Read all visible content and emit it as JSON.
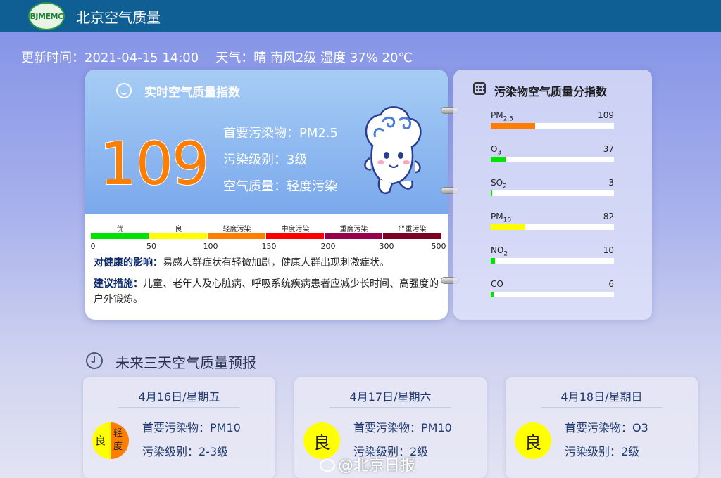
{
  "header": {
    "logo_text": "BJMEMC",
    "title": "北京空气质量"
  },
  "update": {
    "label": "更新时间：",
    "time": "2021-04-15 14:00",
    "weather": "天气：晴 南风2级 湿度 37% 20℃"
  },
  "realtime": {
    "title": "实时空气质量指数",
    "aqi": "109",
    "primary": "首要污染物：PM2.5",
    "level": "污染级别：3级",
    "quality": "空气质量：轻度污染",
    "aqi_color": "#ff7e00",
    "scale": {
      "segments": [
        {
          "label": "优",
          "color": "#00e400"
        },
        {
          "label": "良",
          "color": "#ffff00"
        },
        {
          "label": "轻度污染",
          "color": "#ff7e00"
        },
        {
          "label": "中度污染",
          "color": "#ff0000"
        },
        {
          "label": "重度污染",
          "color": "#99004c"
        },
        {
          "label": "严重污染",
          "color": "#7e0023"
        }
      ],
      "ticks": [
        "0",
        "50",
        "100",
        "150",
        "200",
        "300",
        "500"
      ]
    },
    "health_label": "对健康的影响：",
    "health_text": "易感人群症状有轻微加剧，健康人群出现刺激症状。",
    "advice_label": "建议措施：",
    "advice_text": "儿童、老年人及心脏病、呼吸系统疾病患者应减少长时间、高强度的户外锻炼。"
  },
  "pollutants": {
    "title": "污染物空气质量分指数",
    "icon": "grid-icon",
    "items": [
      {
        "name": "PM",
        "sub": "2.5",
        "value": "109",
        "fraction": 0.36,
        "color": "#ff7e00"
      },
      {
        "name": "O",
        "sub": "3",
        "value": "37",
        "fraction": 0.12,
        "color": "#00e400"
      },
      {
        "name": "SO",
        "sub": "2",
        "value": "3",
        "fraction": 0.012,
        "color": "#00e400"
      },
      {
        "name": "PM",
        "sub": "10",
        "value": "82",
        "fraction": 0.28,
        "color": "#ffff00"
      },
      {
        "name": "NO",
        "sub": "2",
        "value": "10",
        "fraction": 0.035,
        "color": "#00e400"
      },
      {
        "name": "CO",
        "sub": "",
        "value": "6",
        "fraction": 0.025,
        "color": "#00e400"
      }
    ]
  },
  "forecast": {
    "title": "未来三天空气质量预报",
    "days": [
      {
        "date": "4月16日/星期五",
        "badge_left": "良",
        "badge_right": "轻度",
        "primary": "首要污染物：PM10",
        "level": "污染级别：2-3级"
      },
      {
        "date": "4月17日/星期六",
        "badge": "良",
        "primary": "首要污染物：PM10",
        "level": "污染级别：2级"
      },
      {
        "date": "4月18日/星期日",
        "badge": "良",
        "primary": "首要污染物：O3",
        "level": "污染级别：2级"
      }
    ]
  },
  "watermark": "@北京日报"
}
